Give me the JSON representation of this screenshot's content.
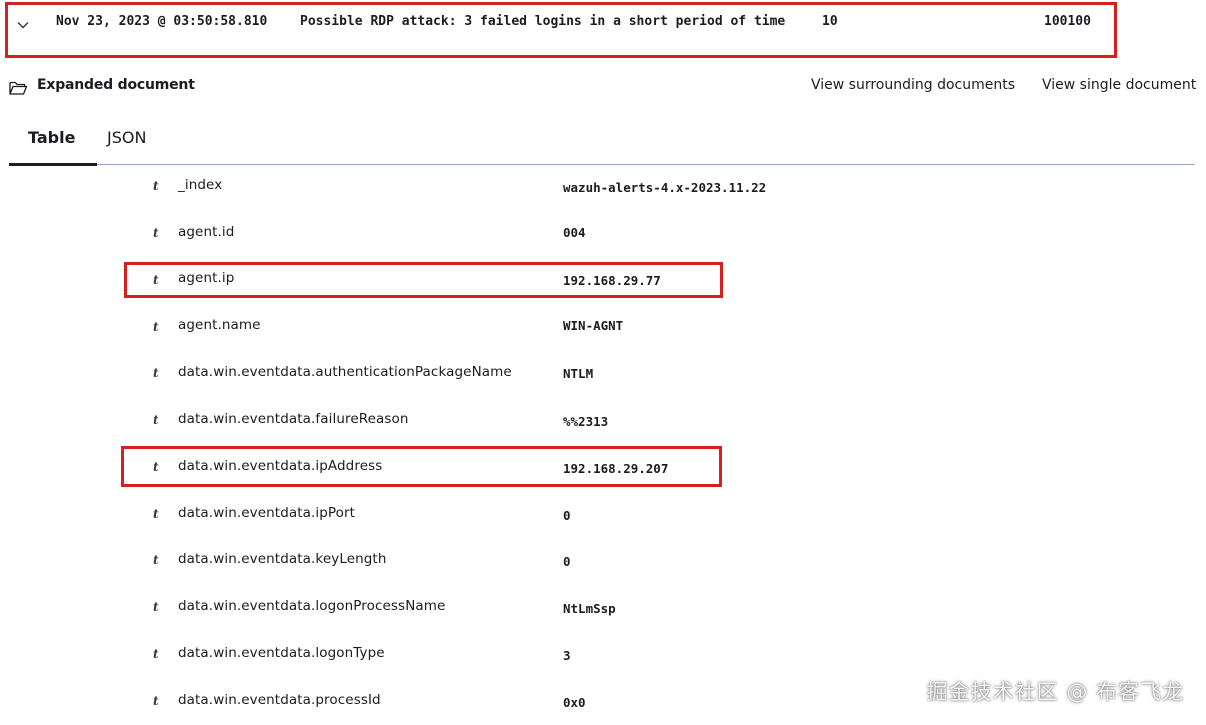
{
  "document_row": {
    "timestamp": "Nov 23, 2023 @ 03:50:58.810",
    "description": "Possible RDP attack: 3 failed logins in a short period of time",
    "rule_level": "10",
    "rule_id": "100100"
  },
  "expanded": {
    "title": "Expanded document",
    "view_surrounding": "View surrounding documents",
    "view_single": "View single document"
  },
  "tabs": [
    {
      "label": "Table"
    },
    {
      "label": "JSON"
    }
  ],
  "fields": [
    {
      "type": "t",
      "name": "_index",
      "value": "wazuh-alerts-4.x-2023.11.22"
    },
    {
      "type": "t",
      "name": "agent.id",
      "value": "004"
    },
    {
      "type": "t",
      "name": "agent.ip",
      "value": "192.168.29.77"
    },
    {
      "type": "t",
      "name": "agent.name",
      "value": "WIN-AGNT"
    },
    {
      "type": "t",
      "name": "data.win.eventdata.authenticationPackageName",
      "value": "NTLM"
    },
    {
      "type": "t",
      "name": "data.win.eventdata.failureReason",
      "value": "%%2313"
    },
    {
      "type": "t",
      "name": "data.win.eventdata.ipAddress",
      "value": "192.168.29.207"
    },
    {
      "type": "t",
      "name": "data.win.eventdata.ipPort",
      "value": "0"
    },
    {
      "type": "t",
      "name": "data.win.eventdata.keyLength",
      "value": "0"
    },
    {
      "type": "t",
      "name": "data.win.eventdata.logonProcessName",
      "value": "NtLmSsp"
    },
    {
      "type": "t",
      "name": "data.win.eventdata.logonType",
      "value": "3"
    },
    {
      "type": "t",
      "name": "data.win.eventdata.processId",
      "value": "0x0"
    }
  ],
  "watermark": "掘金技术社区 @ 布客飞龙",
  "colors": {
    "highlight": "#d61f1f",
    "tab_border": "#8fa6c7",
    "text": "#1a1c21"
  }
}
